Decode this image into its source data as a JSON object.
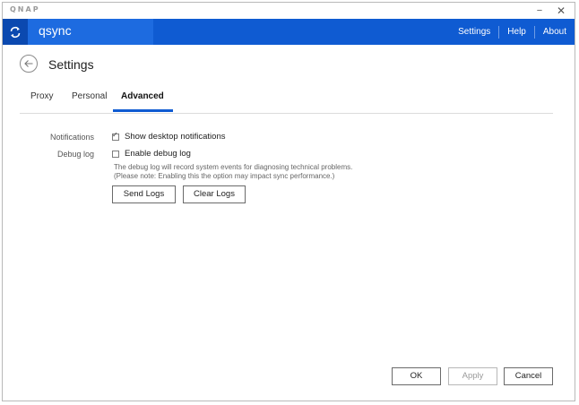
{
  "titlebar": {
    "brand": "QNAP",
    "minimize_icon": "−",
    "close_icon": "✕"
  },
  "appbar": {
    "title": "qsync",
    "nav": [
      "Settings",
      "Help",
      "About"
    ]
  },
  "page": {
    "title": "Settings",
    "tabs": [
      "Proxy",
      "Personal",
      "Advanced"
    ],
    "active_tab": "Advanced"
  },
  "advanced": {
    "notifications": {
      "label": "Notifications",
      "option": "Show desktop notifications",
      "checked": true
    },
    "debug": {
      "label": "Debug log",
      "option": "Enable debug log",
      "checked": false,
      "description_1": "The debug log will record system events for diagnosing technical problems.",
      "description_2": "(Please note: Enabling this the option may impact sync performance.)"
    },
    "buttons": {
      "send_logs": "Send Logs",
      "clear_logs": "Clear Logs"
    }
  },
  "footer": {
    "ok": "OK",
    "apply": "Apply",
    "cancel": "Cancel"
  },
  "colors": {
    "accent": "#0f5bd2",
    "appbar_title_bg": "#1d6be0",
    "sync_tile_bg": "#0b49b0"
  }
}
